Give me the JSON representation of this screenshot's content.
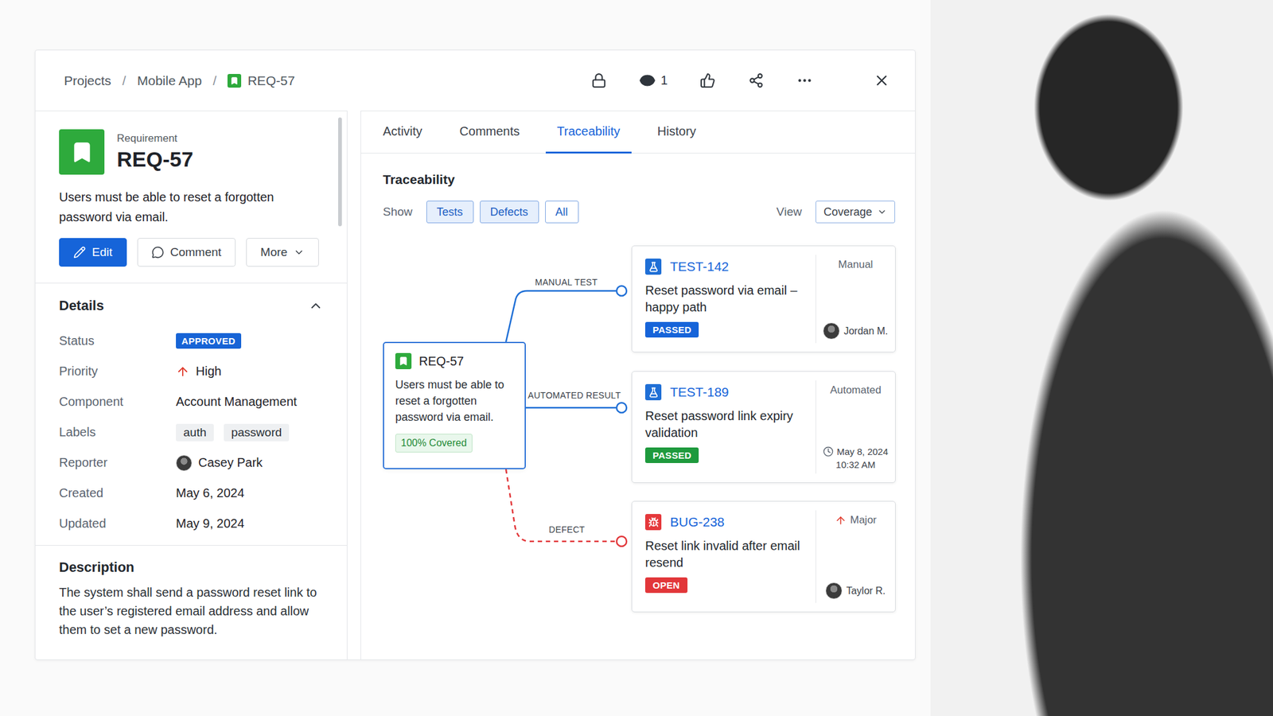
{
  "header": {
    "breadcrumb": [
      "Projects",
      "Mobile App",
      "REQ-57"
    ],
    "separator": "/",
    "watchers": "1"
  },
  "item": {
    "type": "Requirement",
    "key": "REQ-57",
    "summary": "Users must be able to reset a forgotten password via email."
  },
  "actions": [
    {
      "label": "Edit",
      "kind": "primary"
    },
    {
      "label": "Comment",
      "kind": "secondary"
    },
    {
      "label": "More",
      "kind": "menu"
    }
  ],
  "details": {
    "title": "Details",
    "expanded": true,
    "rows": [
      {
        "label": "Status",
        "kind": "badge",
        "value": "APPROVED"
      },
      {
        "label": "Priority",
        "kind": "priority",
        "value": "High"
      },
      {
        "label": "Component",
        "kind": "text",
        "value": "Account Management"
      },
      {
        "label": "Labels",
        "kind": "chips",
        "values": [
          "auth",
          "password"
        ]
      },
      {
        "label": "Reporter",
        "kind": "person",
        "value": "Casey Park"
      },
      {
        "label": "Created",
        "kind": "text",
        "value": "May 6, 2024"
      },
      {
        "label": "Updated",
        "kind": "text",
        "value": "May 9, 2024"
      }
    ]
  },
  "description": {
    "title": "Description",
    "text": "The system shall send a password reset link to the user’s registered email address and allow them to set a new password."
  },
  "tabs": [
    {
      "label": "Activity",
      "selected": false
    },
    {
      "label": "Comments",
      "selected": false
    },
    {
      "label": "Traceability",
      "selected": true
    },
    {
      "label": "History",
      "selected": false
    }
  ],
  "traceability": {
    "title": "Traceability",
    "show_label": "Show",
    "filters": [
      {
        "label": "Tests",
        "selected": true
      },
      {
        "label": "Defects",
        "selected": true
      },
      {
        "label": "All",
        "selected": false
      }
    ],
    "view_label": "View",
    "view": "Coverage",
    "root": {
      "key": "REQ-57",
      "text": "Users must be able to reset a forgotten password via email.",
      "coverage": "100% Covered"
    },
    "links": [
      {
        "label": "MANUAL TEST",
        "style": "solid",
        "color": "#1f6fd6",
        "target": {
          "kind": "manual",
          "key": "TEST-142",
          "title": "Reset password via email – happy path",
          "status": "PASSED",
          "status_color": "#1664d9",
          "tag": "Manual",
          "assignee": "Jordan M."
        }
      },
      {
        "label": "AUTOMATED RESULT",
        "style": "solid",
        "color": "#1f6fd6",
        "target": {
          "kind": "automated",
          "key": "TEST-189",
          "title": "Reset password link expiry validation",
          "status": "PASSED",
          "status_color": "#1e9a3d",
          "tag": "Automated",
          "date": "May 8, 2024",
          "time": "10:32 AM"
        }
      },
      {
        "label": "DEFECT",
        "style": "dashed",
        "color": "#e2373a",
        "target": {
          "kind": "defect",
          "key": "BUG-238",
          "title": "Reset link invalid after email resend",
          "status": "OPEN",
          "status_color": "#e2373a",
          "tag": "Major",
          "assignee": "Taylor R."
        }
      }
    ]
  }
}
